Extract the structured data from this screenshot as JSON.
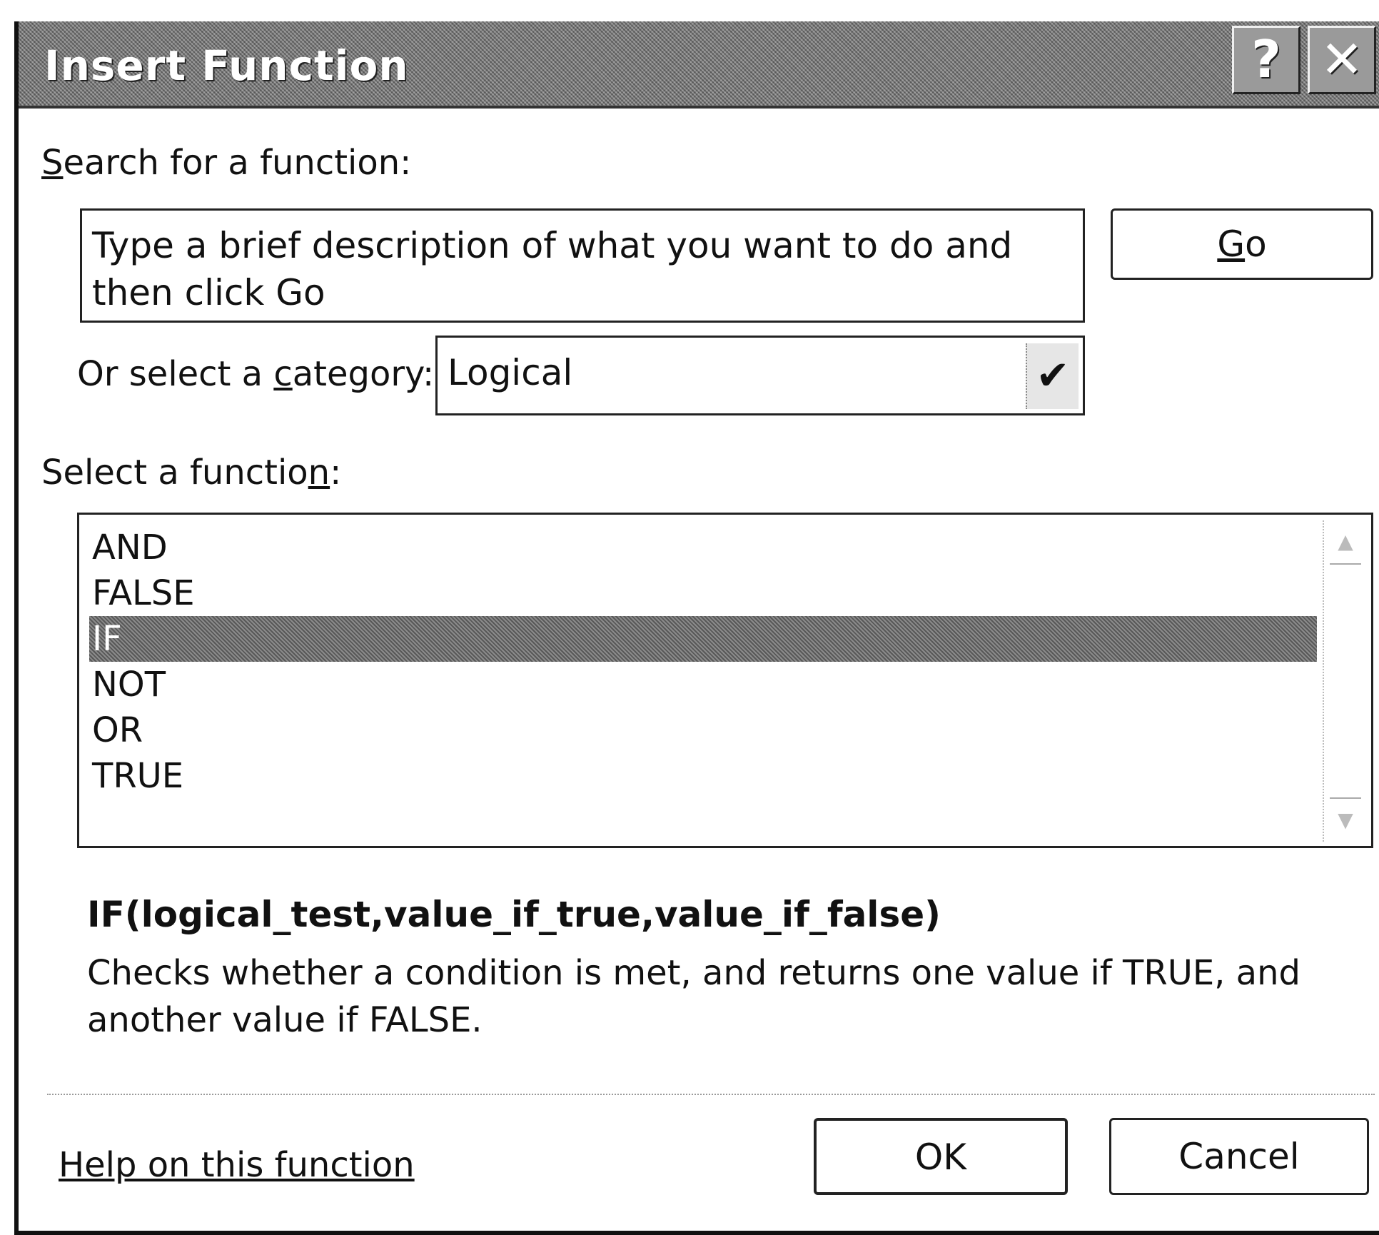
{
  "window": {
    "title": "Insert Function",
    "help_glyph": "?",
    "close_glyph": "✕"
  },
  "search": {
    "label_accel": "S",
    "label_rest": "earch for a function:",
    "value": "Type a brief description of what you want to do and then click Go",
    "go_accel": "G",
    "go_rest": "o"
  },
  "category": {
    "label_pre": "Or select a ",
    "label_accel": "c",
    "label_post": "ategory:",
    "selected": "Logical",
    "arrow_glyph": "✔"
  },
  "functions": {
    "label_pre": "Select a functio",
    "label_accel": "n",
    "label_post": ":",
    "items": [
      "AND",
      "FALSE",
      "IF",
      "NOT",
      "OR",
      "TRUE"
    ],
    "selected_index": 2,
    "scroll_up_glyph": "▲",
    "scroll_down_glyph": "▼"
  },
  "details": {
    "signature": "IF(logical_test,value_if_true,value_if_false)",
    "description": "Checks whether a condition is met, and returns one value if TRUE, and another value if FALSE."
  },
  "footer": {
    "help_link": "Help on this function",
    "ok_label": "OK",
    "cancel_label": "Cancel"
  }
}
